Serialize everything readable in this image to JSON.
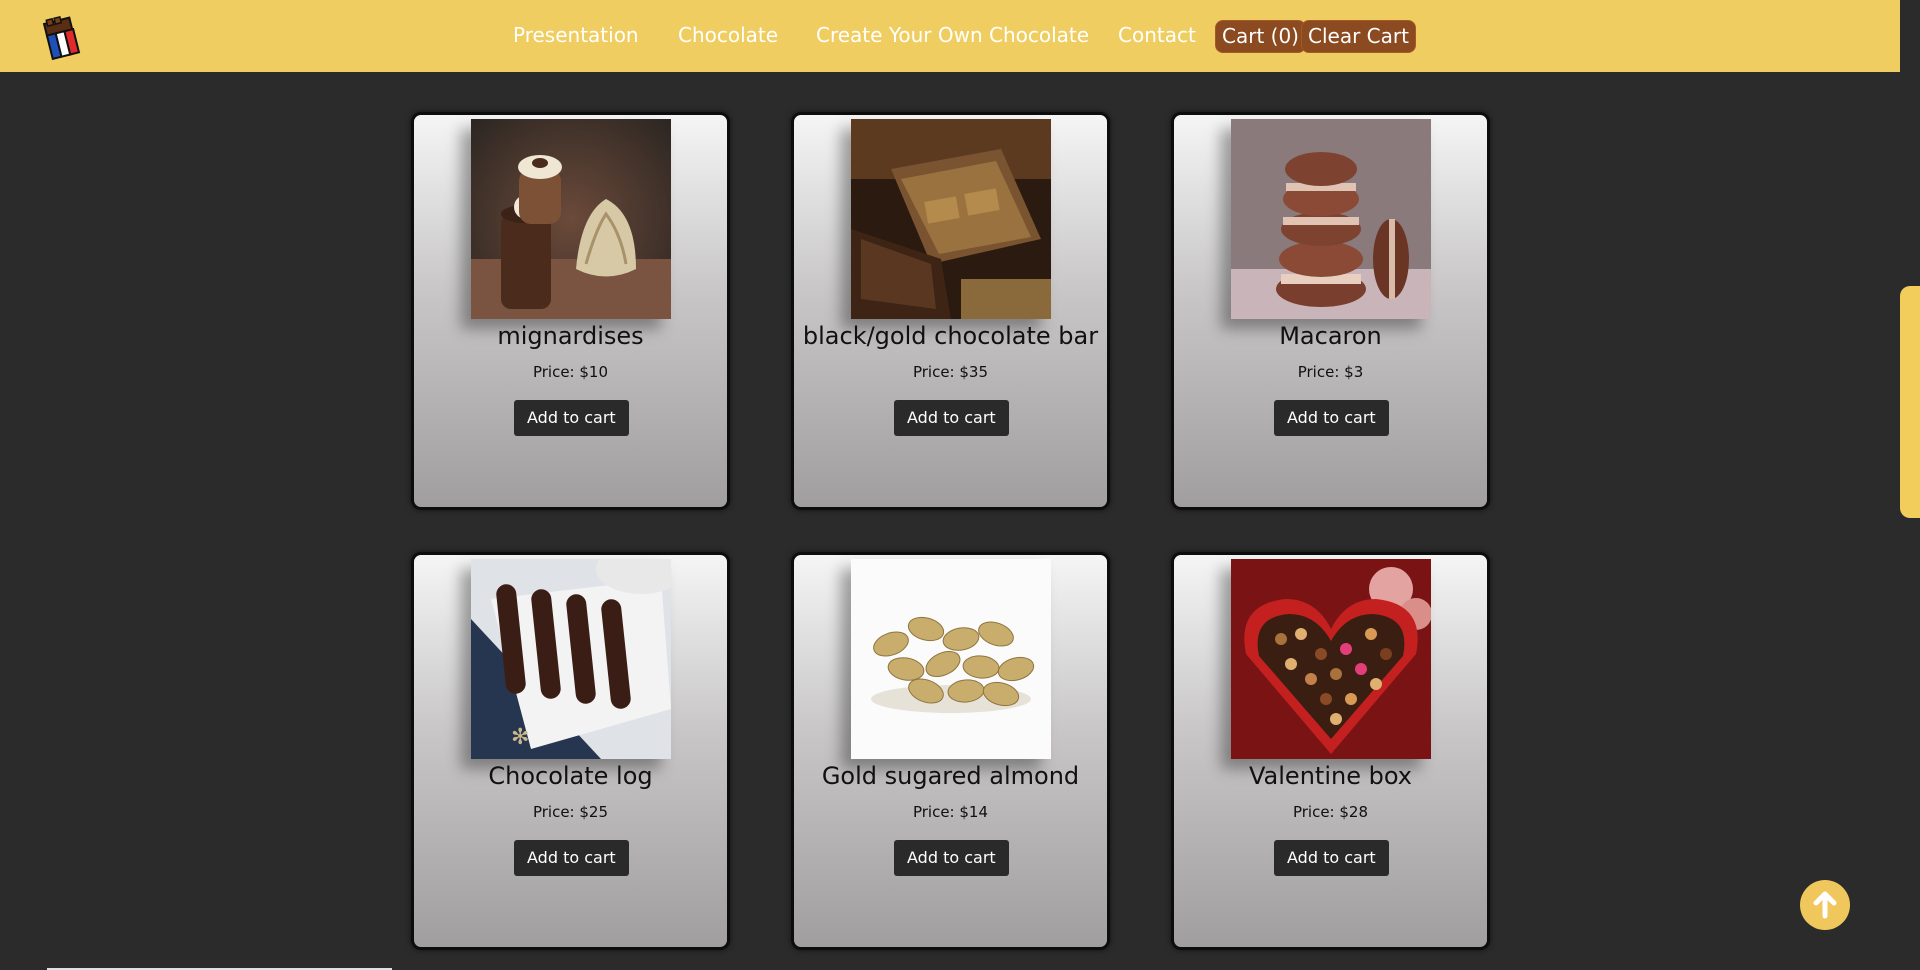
{
  "colors": {
    "navbar": "#f0cd60",
    "page_background": "#2b2b2b",
    "cart_button": "#8b4a1f",
    "add_button": "#2a2a2a",
    "back_to_top": "#f0c75c"
  },
  "header": {
    "logo_icon": "chocolate-bar-french-flag-logo",
    "nav": [
      "Presentation",
      "Chocolate",
      "Create Your Own Chocolate",
      "Contact"
    ],
    "cart_label": "Cart (0)",
    "clear_cart_label": "Clear Cart"
  },
  "products": [
    {
      "name": "mignardises",
      "price": "Price: $10",
      "button": "Add to cart",
      "image_icon": "mignardises-photo"
    },
    {
      "name": "black/gold chocolate bar",
      "price": "Price: $35",
      "button": "Add to cart",
      "image_icon": "chocolate-bar-photo"
    },
    {
      "name": "Macaron",
      "price": "Price: $3",
      "button": "Add to cart",
      "image_icon": "macaron-photo"
    },
    {
      "name": "Chocolate log",
      "price": "Price: $25",
      "button": "Add to cart",
      "image_icon": "chocolate-log-photo"
    },
    {
      "name": "Gold sugared almond",
      "price": "Price: $14",
      "button": "Add to cart",
      "image_icon": "sugared-almond-photo"
    },
    {
      "name": "Valentine box",
      "price": "Price: $28",
      "button": "Add to cart",
      "image_icon": "valentine-box-photo"
    }
  ],
  "back_to_top_icon": "arrow-up-icon"
}
